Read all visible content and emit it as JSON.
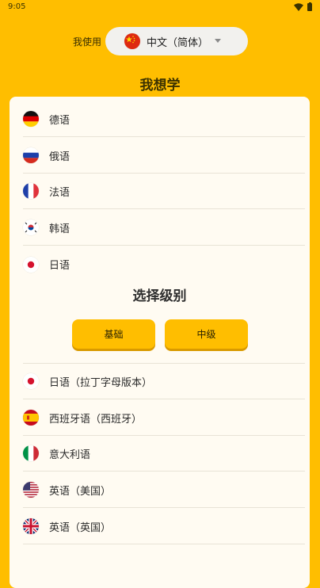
{
  "status_bar": {
    "time": "9:05"
  },
  "native_language": {
    "label": "我使用",
    "selected": "中文（简体）",
    "flag": "china-flag-icon"
  },
  "heading": "我想学",
  "languages_top": [
    {
      "label": "德语",
      "flag": "germany-flag-icon"
    },
    {
      "label": "俄语",
      "flag": "russia-flag-icon"
    },
    {
      "label": "法语",
      "flag": "france-flag-icon"
    },
    {
      "label": "韩语",
      "flag": "south-korea-flag-icon"
    },
    {
      "label": "日语",
      "flag": "japan-flag-icon"
    }
  ],
  "level_picker": {
    "title": "选择级别",
    "options": [
      "基础",
      "中级"
    ]
  },
  "languages_bottom": [
    {
      "label": "日语（拉丁字母版本）",
      "flag": "japan-flag-icon"
    },
    {
      "label": "西班牙语（西班牙）",
      "flag": "spain-flag-icon"
    },
    {
      "label": "意大利语",
      "flag": "italy-flag-icon"
    },
    {
      "label": "英语（美国）",
      "flag": "usa-flag-icon"
    },
    {
      "label": "英语（英国）",
      "flag": "uk-flag-icon"
    }
  ],
  "colors": {
    "accent": "#FFBE00",
    "card": "#FFFBF2"
  }
}
